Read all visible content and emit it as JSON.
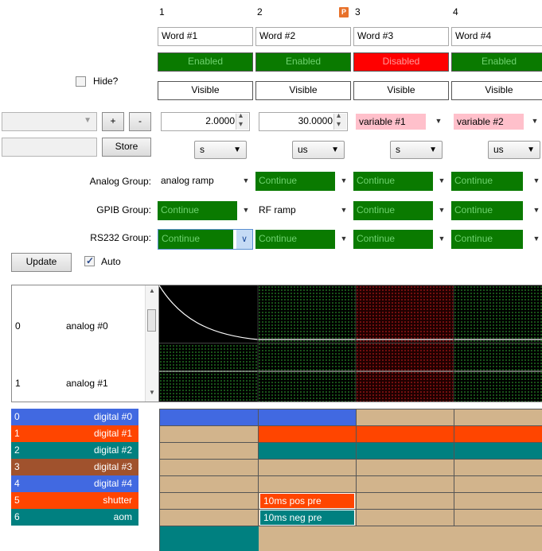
{
  "columns": [
    {
      "number": "1",
      "name": "Word #1",
      "state": "Enabled",
      "visibility": "Visible",
      "duration": "2.0000",
      "unit": "s",
      "analog": "analog ramp",
      "gpib": "Continue",
      "rs232": "Continue"
    },
    {
      "number": "2",
      "name": "Word #2",
      "state": "Enabled",
      "visibility": "Visible",
      "duration": "30.0000",
      "unit": "us",
      "analog": "Continue",
      "gpib": "RF ramp",
      "rs232": "Continue"
    },
    {
      "number": "3",
      "name": "Word #3",
      "state": "Disabled",
      "visibility": "Visible",
      "duration": "variable #1",
      "unit": "s",
      "analog": "Continue",
      "gpib": "Continue",
      "rs232": "Continue"
    },
    {
      "number": "4",
      "name": "Word #4",
      "state": "Enabled",
      "visibility": "Visible",
      "duration": "variable #2",
      "unit": "us",
      "analog": "Continue",
      "gpib": "Continue",
      "rs232": "Continue"
    }
  ],
  "p_badge": "P",
  "left_panel": {
    "hide_label": "Hide?",
    "plus_label": "+",
    "minus_label": "-",
    "store_label": "Store",
    "update_label": "Update",
    "auto_label": "Auto",
    "auto_checked": true,
    "hide_checked": false
  },
  "group_labels": {
    "analog": "Analog Group:",
    "gpib": "GPIB Group:",
    "rs232": "RS232 Group:"
  },
  "analog_channels": [
    {
      "index": "0",
      "name": "analog #0"
    },
    {
      "index": "1",
      "name": "analog #1"
    }
  ],
  "digital_channels": [
    {
      "index": "0",
      "name": "digital #0",
      "color": "#4169e1"
    },
    {
      "index": "1",
      "name": "digital #1",
      "color": "#ff4500"
    },
    {
      "index": "2",
      "name": "digital #2",
      "color": "#008080"
    },
    {
      "index": "3",
      "name": "digital #3",
      "color": "#a0522d"
    },
    {
      "index": "4",
      "name": "digital #4",
      "color": "#4169e1"
    },
    {
      "index": "5",
      "name": "shutter",
      "color": "#ff4500"
    },
    {
      "index": "6",
      "name": "aom",
      "color": "#008080"
    }
  ],
  "pulse_labels": {
    "shutter": "10ms pos pre",
    "aom": "10ms neg pre"
  },
  "colors": {
    "enabled": "#0a7a00",
    "disabled": "#ff0000",
    "tan": "#d2b48c",
    "variable_bg": "#ffc0cb"
  }
}
